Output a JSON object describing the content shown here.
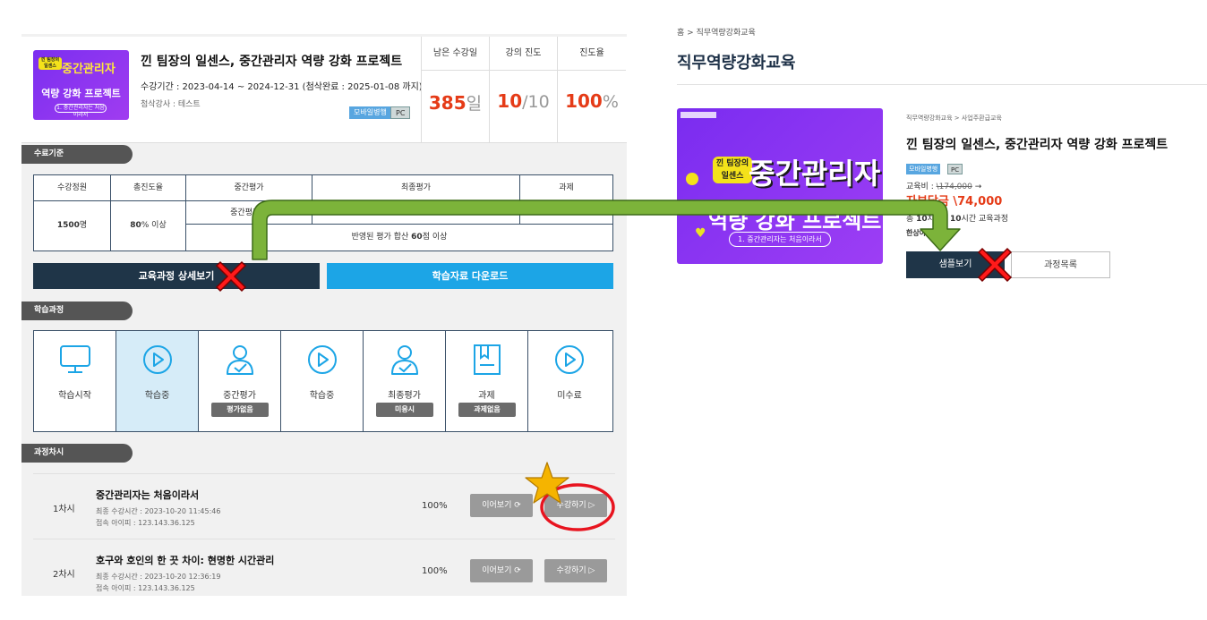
{
  "left": {
    "course": {
      "title": "낀 팀장의 일센스, 중간관리자 역량 강화 프로젝트",
      "period": "수강기간 : 2023-04-14 ~ 2024-12-31 (첨삭완료 : 2025-01-08 까지)",
      "teacher": "첨삭강사 : 테스트",
      "badge_mobile": "모바일병행",
      "badge_pc": "PC",
      "thumb_tag": "낀 팀장의 일센스",
      "thumb_line1": "중간관리자",
      "thumb_line2": "역량 강화 프로젝트",
      "thumb_line3": "1. 중간관리자는 처음이라서"
    },
    "stats": [
      {
        "label": "남은 수강일",
        "value": "385",
        "unit": "일"
      },
      {
        "label": "강의 진도",
        "value": "10",
        "unit": "/10"
      },
      {
        "label": "진도율",
        "value": "100",
        "unit": "%"
      }
    ],
    "criteria": {
      "tag": "수료기준",
      "headers": [
        "수강정원",
        "총진도율",
        "중간평가",
        "최종평가",
        "과제"
      ],
      "capacity_num": "1500",
      "capacity_unit": "명",
      "progress_num": "80",
      "progress_unit": "% 이상",
      "mid_sub": "중간평가 9",
      "sum_prefix": "반영된 평가 합산 ",
      "sum_num": "60",
      "sum_suffix": "점 이상"
    },
    "buttons": {
      "detail": "교육과정 상세보기",
      "download": "학습자료 다운로드"
    },
    "steps_tag": "학습과정",
    "steps": [
      {
        "label": "학습시작",
        "pill": ""
      },
      {
        "label": "학습중",
        "pill": ""
      },
      {
        "label": "중간평가",
        "pill": "평가없음"
      },
      {
        "label": "학습중",
        "pill": ""
      },
      {
        "label": "최종평가",
        "pill": "미응시"
      },
      {
        "label": "과제",
        "pill": "과제없음"
      },
      {
        "label": "미수료",
        "pill": ""
      }
    ],
    "lessons_tag": "과정차시",
    "lessons": [
      {
        "num": "1차시",
        "title": "중간관리자는 처음이라서",
        "last_time": "최종 수강시간 : 2023-10-20 11:45:46",
        "ip": "접속 아이피 : 123.143.36.125",
        "pct": "100%",
        "resume": "이어보기 ⟳",
        "watch": "수강하기 ▷"
      },
      {
        "num": "2차시",
        "title": "호구와 호인의 한 끗 차이: 현명한 시간관리",
        "last_time": "최종 수강시간 : 2023-10-20 12:36:19",
        "ip": "접속 아이피 : 123.143.36.125",
        "pct": "100%",
        "resume": "이어보기 ⟳",
        "watch": "수강하기 ▷"
      }
    ]
  },
  "right": {
    "breadcrumb": "홈 > 직무역량강화교육",
    "title": "직무역량강화교육",
    "category": "직무역량강화교육 > 사업주환급교육",
    "course_title": "낀 팀장의 일센스, 중간관리자 역량 강화 프로젝트",
    "badge_mobile": "모바일병행",
    "badge_pc": "PC",
    "fee_label": "교육비 : ",
    "fee_original": "\\174,000",
    "fee_arrow": "→",
    "self_pay": "자부담금 \\74,000",
    "info_prefix": "총 ",
    "info_num1": "10",
    "info_mid": "차시 / ",
    "info_num2": "10",
    "info_suffix": "시간 교육과정",
    "teacher": "한상아 강사",
    "thumb_tag": "낀 팀장의 일센스",
    "thumb_line1": "중간관리자",
    "thumb_line2": "역량 강화 프로젝트",
    "thumb_line3": "1. 중간관리자는 처음이라서",
    "sample_button": "샘플보기",
    "list_button": "과정목록"
  },
  "colors": {
    "navy": "#1f3548",
    "blue": "#1ca5e6",
    "accent": "#e53b17",
    "arrow_green": "#7cb33a",
    "x_red": "#ff1a1a",
    "star": "#f5b400",
    "circle": "#e8141f"
  }
}
